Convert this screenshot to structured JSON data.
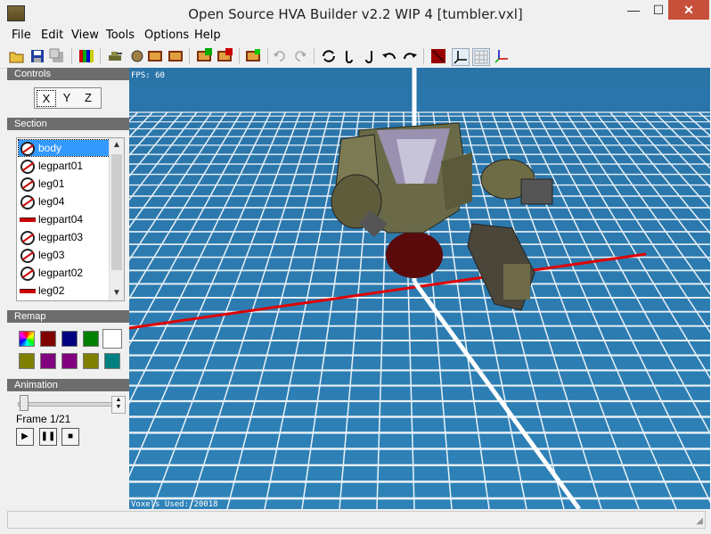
{
  "window": {
    "title": "Open Source HVA Builder v2.2 WIP 4 [tumbler.vxl]",
    "minimize": "—",
    "maximize": "☐",
    "close": "✕"
  },
  "menu": [
    "File",
    "Edit",
    "View",
    "Tools",
    "Options",
    "Help"
  ],
  "controls": {
    "header": "Controls",
    "axes": [
      "X",
      "Y",
      "Z"
    ]
  },
  "section": {
    "header": "Section",
    "items": [
      {
        "label": "body",
        "icon": "no-symbol-icon",
        "selected": true
      },
      {
        "label": "legpart01",
        "icon": "no-symbol-icon"
      },
      {
        "label": "leg01",
        "icon": "no-symbol-icon"
      },
      {
        "label": "leg04",
        "icon": "no-symbol-icon"
      },
      {
        "label": "legpart04",
        "icon": "red-bar-icon"
      },
      {
        "label": "legpart03",
        "icon": "no-symbol-icon"
      },
      {
        "label": "leg03",
        "icon": "no-symbol-icon"
      },
      {
        "label": "legpart02",
        "icon": "no-symbol-icon"
      },
      {
        "label": "leg02",
        "icon": "red-bar-icon"
      }
    ]
  },
  "remap": {
    "header": "Remap",
    "colors": [
      "multicolor",
      "#800000",
      "#000080",
      "#008000",
      "#ffffff",
      "#808000",
      "#800080",
      "#800080",
      "#808000",
      "#008080"
    ]
  },
  "animation": {
    "header": "Animation",
    "frame_label": "Frame 1/21",
    "buttons": [
      "play",
      "pause",
      "stop"
    ],
    "current_frame": 1,
    "total_frames": 21
  },
  "viewport": {
    "fps_text": "FPS: 60",
    "voxels_text": "Voxels Used: 20018",
    "background_color": "#2b7cb0",
    "grid_color": "#ffffff",
    "axis_x_color": "#e00000",
    "axis_y_color": "#ffffff"
  }
}
